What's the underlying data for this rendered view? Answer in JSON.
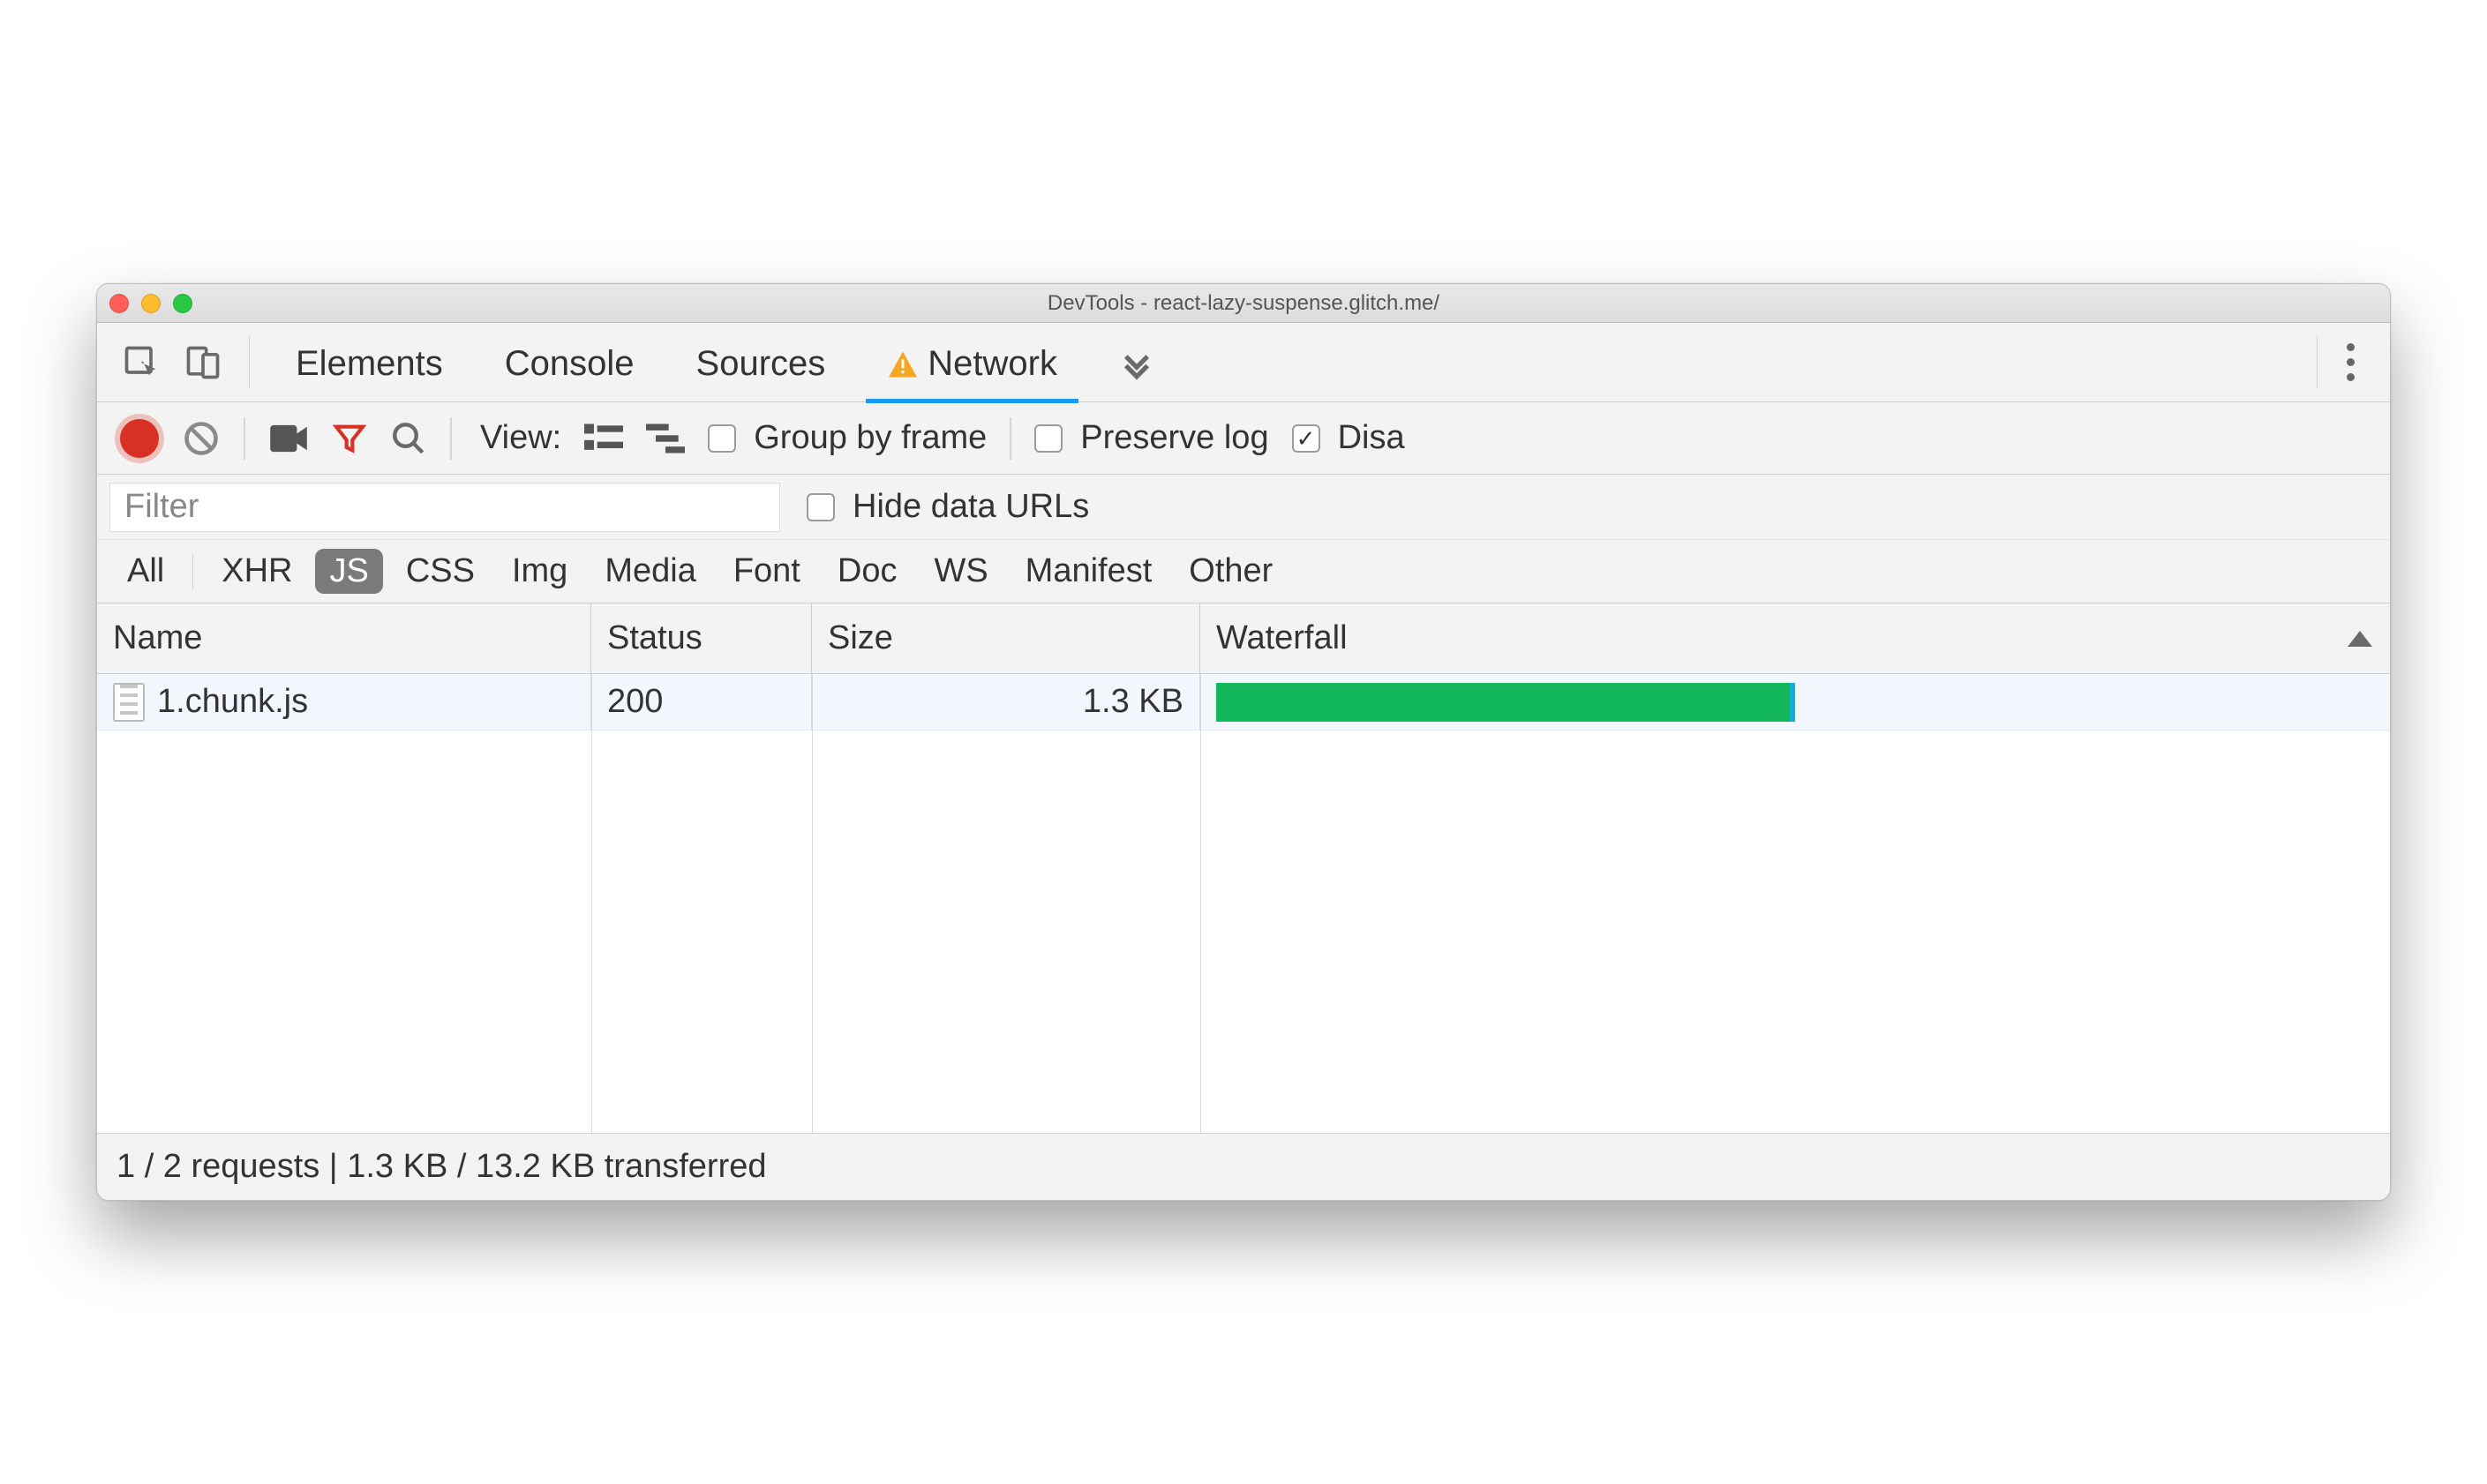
{
  "window": {
    "title": "DevTools - react-lazy-suspense.glitch.me/"
  },
  "tabs": {
    "items": [
      "Elements",
      "Console",
      "Sources",
      "Network"
    ],
    "active": "Network",
    "has_warning": true
  },
  "toolbar": {
    "view_label": "View:",
    "group_by_frame_label": "Group by frame",
    "preserve_log_label": "Preserve log",
    "disable_cache_label_partial": "Disa",
    "group_by_frame_checked": false,
    "preserve_log_checked": false,
    "disable_cache_checked": true
  },
  "filter": {
    "placeholder": "Filter",
    "hide_data_urls_label": "Hide data URLs",
    "hide_data_urls_checked": false
  },
  "type_filters": {
    "items": [
      "All",
      "XHR",
      "JS",
      "CSS",
      "Img",
      "Media",
      "Font",
      "Doc",
      "WS",
      "Manifest",
      "Other"
    ],
    "active": "JS"
  },
  "table": {
    "columns": {
      "name": "Name",
      "status": "Status",
      "size": "Size",
      "waterfall": "Waterfall"
    },
    "rows": [
      {
        "name": "1.chunk.js",
        "status": "200",
        "size": "1.3 KB",
        "waterfall_pct": 50
      }
    ]
  },
  "status_footer": "1 / 2 requests | 1.3 KB / 13.2 KB transferred"
}
